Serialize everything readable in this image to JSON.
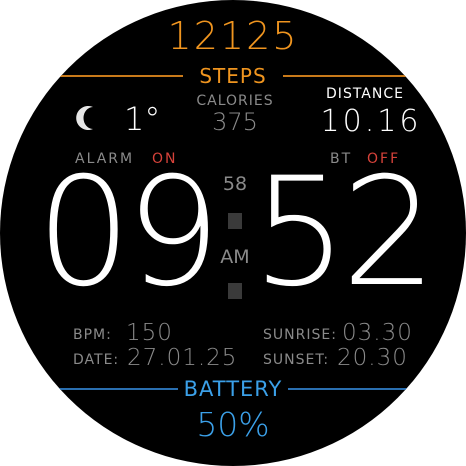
{
  "steps": {
    "value": "12125",
    "label": "STEPS"
  },
  "weather": {
    "icon": "moon-icon",
    "temperature": "1°"
  },
  "calories": {
    "label": "CALORIES",
    "value": "375"
  },
  "distance": {
    "label": "DISTANCE",
    "value": "10.16"
  },
  "alarm": {
    "label": "ALARM",
    "state": "ON"
  },
  "bluetooth": {
    "label": "BT",
    "state": "OFF"
  },
  "time": {
    "hours": "09",
    "minutes": "52",
    "seconds": "58",
    "ampm": "AM"
  },
  "info": {
    "bpm_label": "BPM:",
    "bpm_value": "150",
    "date_label": "DATE:",
    "date_value": "27.01.25",
    "sunrise_label": "SUNRISE:",
    "sunrise_value": "03.30",
    "sunset_label": "SUNSET:",
    "sunset_value": "20.30"
  },
  "battery": {
    "label": "BATTERY",
    "value": "50%"
  },
  "colors": {
    "steps_accent": "#f0951f",
    "battery_accent": "#3ba0e8",
    "status_state": "#d6423a",
    "secondary_text": "#8a8a8a",
    "background": "#000000"
  }
}
